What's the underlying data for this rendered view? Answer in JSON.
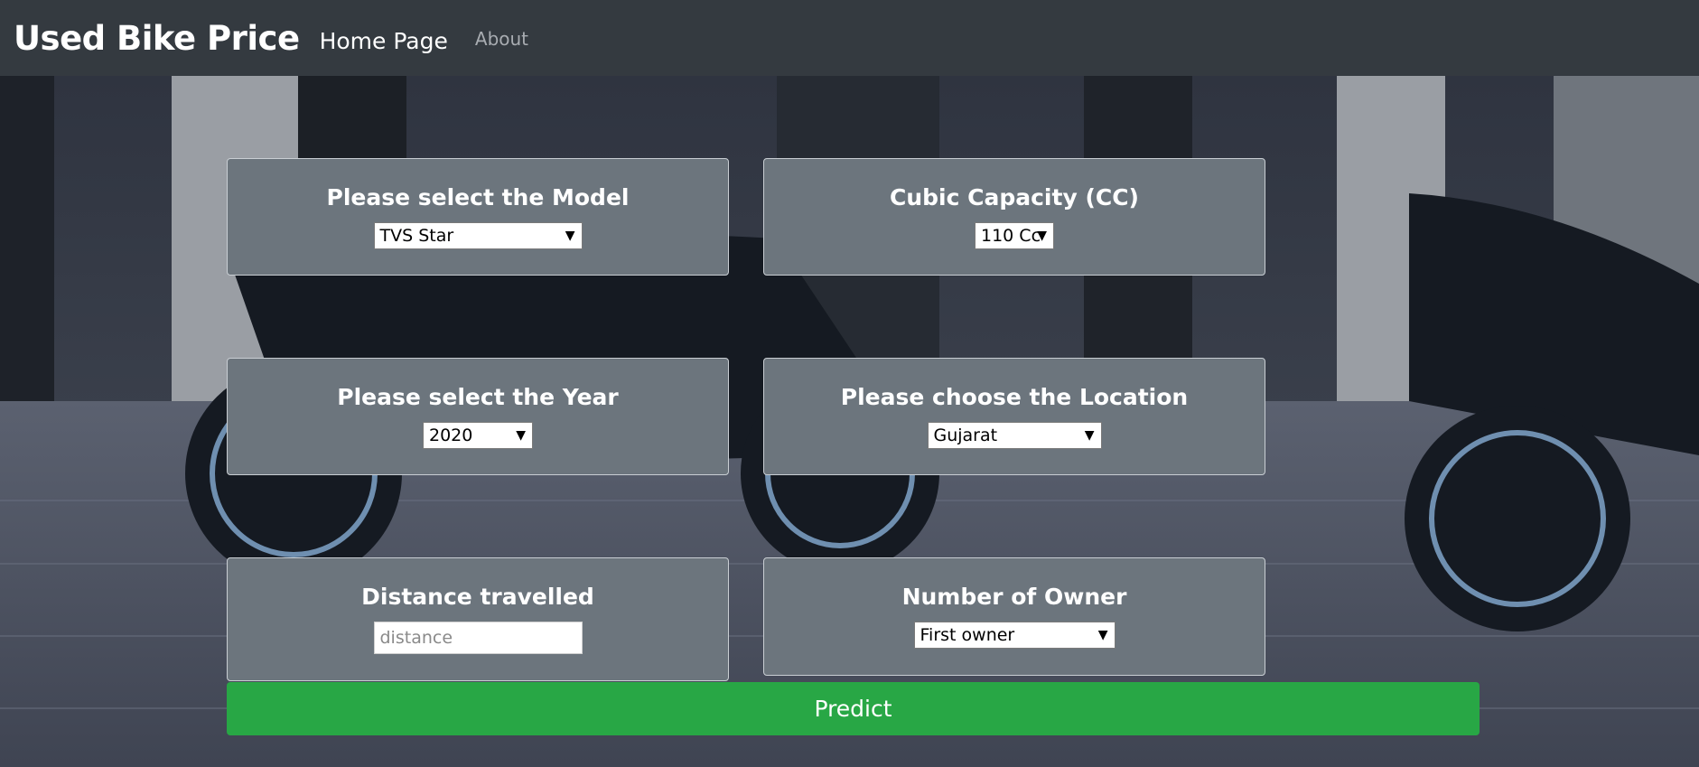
{
  "nav": {
    "brand": "Used Bike Price",
    "home": "Home Page",
    "about": "About"
  },
  "form": {
    "model": {
      "label": "Please select the Model",
      "value": "TVS Star"
    },
    "cc": {
      "label": "Cubic Capacity (CC)",
      "value": "110 Cc"
    },
    "year": {
      "label": "Please select the Year",
      "value": "2020"
    },
    "location": {
      "label": "Please choose the Location",
      "value": "Gujarat"
    },
    "distance": {
      "label": "Distance travelled",
      "placeholder": "distance"
    },
    "owner": {
      "label": "Number of Owner",
      "value": "First owner"
    },
    "predict": "Predict"
  },
  "colors": {
    "navbar": "#343a40",
    "card": "#6c757d",
    "predict": "#28a745"
  },
  "icons": {
    "chevron": "chevron-down-icon"
  }
}
